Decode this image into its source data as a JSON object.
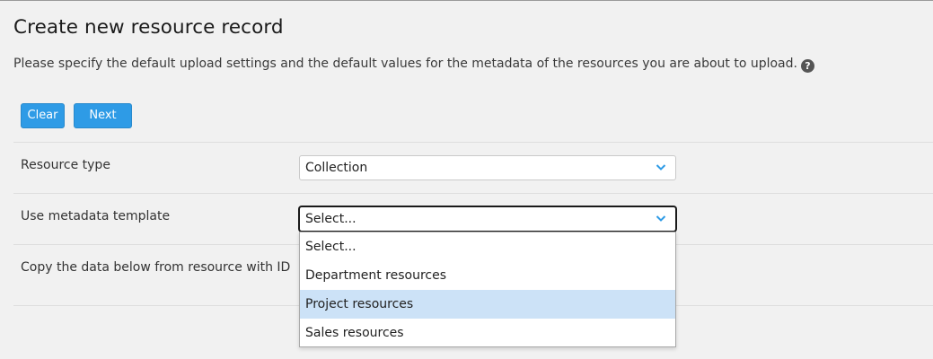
{
  "page": {
    "title": "Create new resource record",
    "intro": "Please specify the default upload settings and the default values for the metadata of the resources you are about to upload."
  },
  "buttons": {
    "clear_label": "Clear",
    "next_label": "Next"
  },
  "fields": {
    "resource_type": {
      "label": "Resource type",
      "value": "Collection"
    },
    "metadata_template": {
      "label": "Use metadata template",
      "value": "Select...",
      "options": [
        "Select...",
        "Department resources",
        "Project resources",
        "Sales resources"
      ],
      "highlighted_option": "Project resources"
    },
    "copy_from": {
      "label": "Copy the data below from resource with ID"
    }
  },
  "colors": {
    "accent": "#2e9be6",
    "chevron": "#2e9be6",
    "highlight": "#cce2f7",
    "background": "#f1f1f1"
  },
  "icons": {
    "help": "help-icon",
    "chevron": "chevron-down-icon"
  }
}
